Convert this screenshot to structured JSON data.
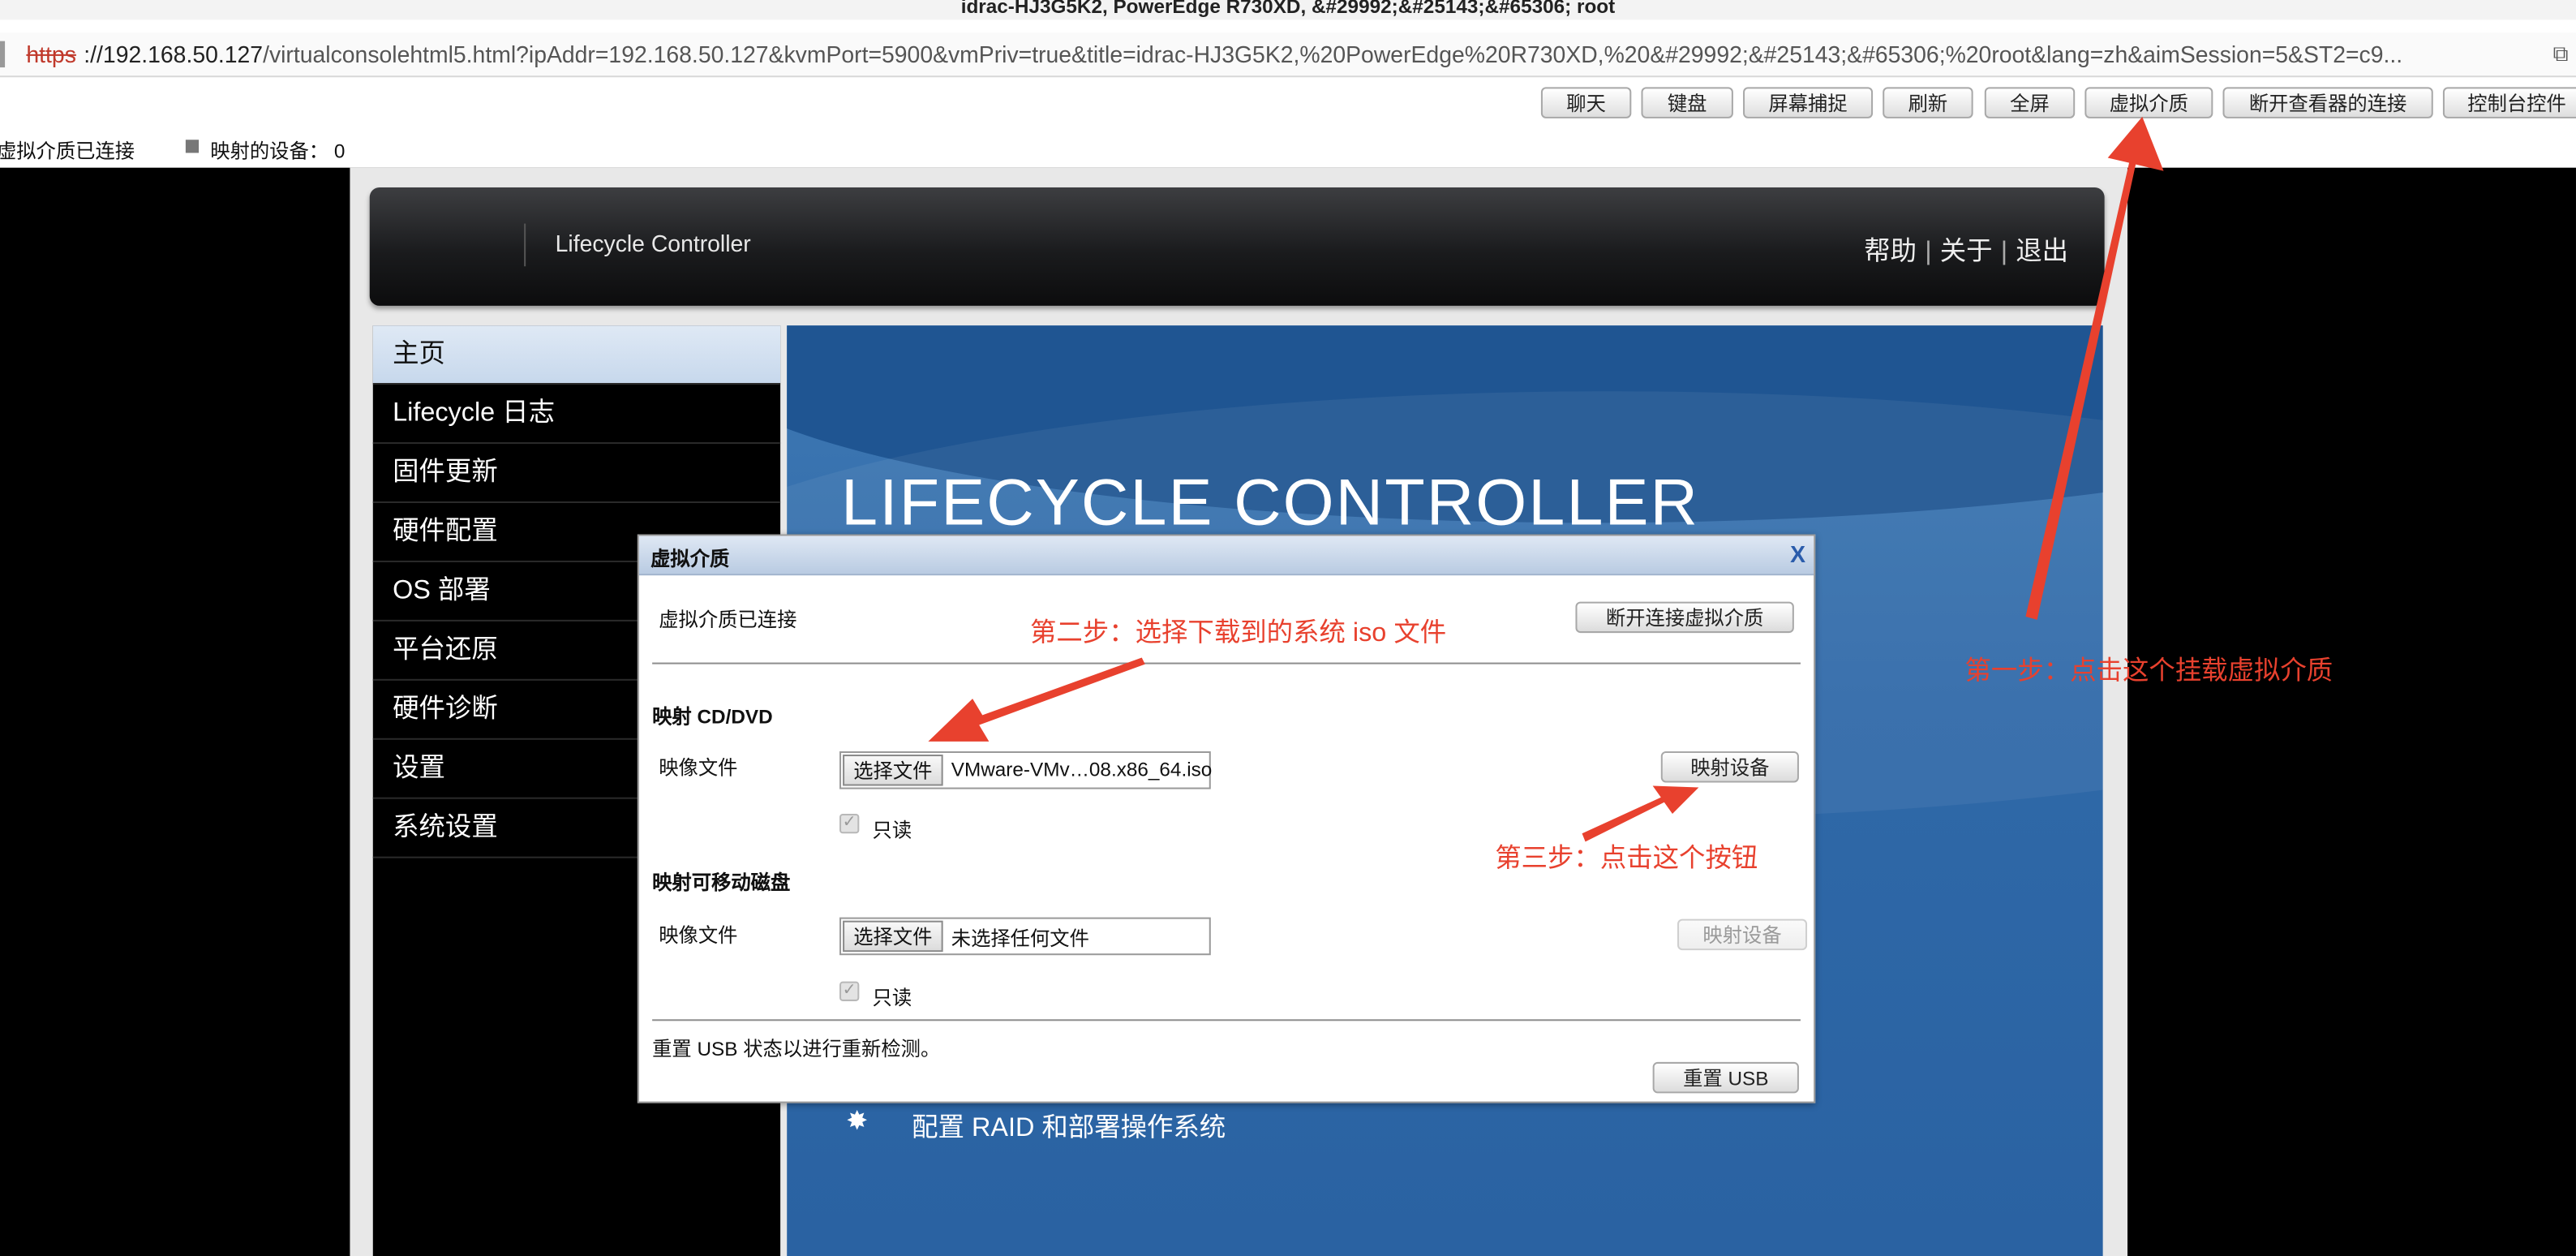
{
  "window_title": "idrac-HJ3G5K2, PowerEdge R730XD, &#29992;&#25143;&#65306; root",
  "url": {
    "protocol": "https",
    "host": "://192.168.50.127",
    "rest": "/virtualconsolehtml5.html?ipAddr=192.168.50.127&kvmPort=5900&vmPriv=true&title=idrac-HJ3G5K2,%20PowerEdge%20R730XD,%20&#29992;&#25143;&#65306;%20root&lang=zh&aimSession=5&ST2=c9..."
  },
  "toolbar": {
    "buttons": [
      "聊天",
      "键盘",
      "屏幕捕捉",
      "刷新",
      "全屏",
      "虚拟介质",
      "断开查看器的连接",
      "控制台控件"
    ]
  },
  "status": {
    "vm_connected": "虚拟介质已连接",
    "mapped_devices": "映射的设备： 0"
  },
  "lifecycle": {
    "title": "Lifecycle Controller",
    "links": {
      "help": "帮助",
      "about": "关于",
      "exit": "退出"
    },
    "nav": [
      "主页",
      "Lifecycle 日志",
      "固件更新",
      "硬件配置",
      "OS 部署",
      "平台还原",
      "硬件诊断",
      "设置",
      "系统设置"
    ],
    "banner": "LIFECYCLE CONTROLLER",
    "config_row": "配置 RAID 和部署操作系统"
  },
  "dialog": {
    "title": "虚拟介质",
    "close": "X",
    "connected_text": "虚拟介质已连接",
    "disconnect_button": "断开连接虚拟介质",
    "cd_section": "映射 CD/DVD",
    "cd_image_label": "映像文件",
    "cd_choose_button": "选择文件",
    "cd_file_name": "VMware-VMv…08.x86_64.iso",
    "cd_map_button": "映射设备",
    "cd_readonly": "只读",
    "removable_section": "映射可移动磁盘",
    "rm_image_label": "映像文件",
    "rm_choose_button": "选择文件",
    "rm_file_name": "未选择任何文件",
    "rm_map_button": "映射设备",
    "rm_readonly": "只读",
    "reset_text": "重置 USB 状态以进行重新检测。",
    "reset_button": "重置 USB"
  },
  "annotations": {
    "step1": "第一步：点击这个挂载虚拟介质",
    "step2": "第二步：选择下载到的系统 iso 文件",
    "step3": "第三步：点击这个按钮",
    "color": "#e8412e"
  }
}
